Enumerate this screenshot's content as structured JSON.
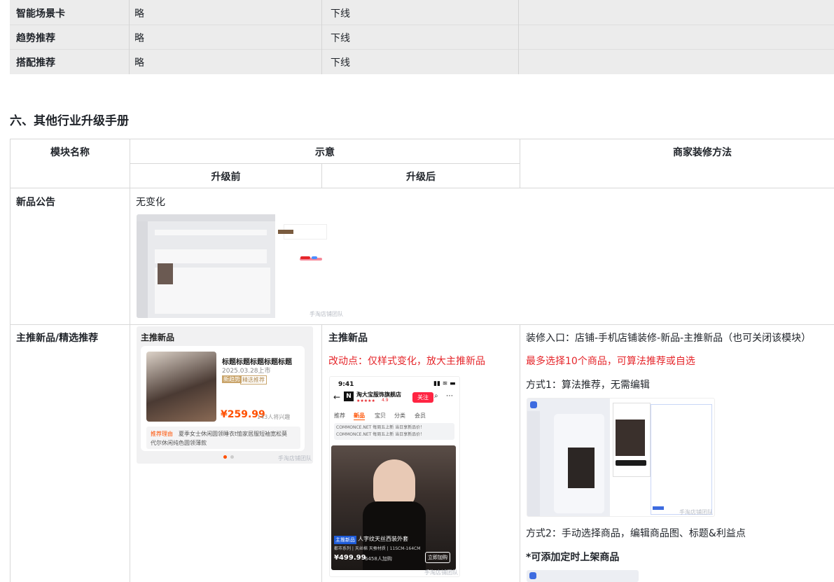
{
  "top_table": {
    "rows": [
      {
        "name": "智能场景卡",
        "col2": "略",
        "col3": "下线"
      },
      {
        "name": "趋势推荐",
        "col2": "略",
        "col3": "下线"
      },
      {
        "name": "搭配推荐",
        "col2": "略",
        "col3": "下线"
      }
    ]
  },
  "section": {
    "title": "六、其他行业升级手册"
  },
  "table": {
    "header": {
      "module": "模块名称",
      "illustration": "示意",
      "method": "商家装修方法",
      "before": "升级前",
      "after": "升级后"
    },
    "row1": {
      "name": "新品公告",
      "note": "无变化",
      "watermark": "手淘店铺团队"
    },
    "row2": {
      "name": "主推新品/精选推荐",
      "before_card": {
        "title": "主推新品",
        "product_title": "标题标题标题标题标题",
        "date": "2025.03.28上市",
        "tag1": "新趋势",
        "tag2": "精选推荐",
        "price": "¥259.99",
        "buyers": "143人将兴趣",
        "reason_label": "推荐理由",
        "reason_text_1": "夏季女士休闲圆领睡衣t恤家居服短袖宽松莫",
        "reason_text_2": "代尔休闲纯色圆领薄款",
        "watermark": "手淘店铺团队"
      },
      "after_title": "主推新品",
      "after_change": "改动点：仅样式变化，放大主推新品",
      "phone": {
        "time": "9:41",
        "shop_name": "淘大宝服饰旗舰店",
        "shop_rating": "4.9",
        "follow": "关注",
        "tabs": [
          "推荐",
          "新品",
          "宝贝",
          "分类",
          "会员"
        ],
        "notice": "COMMONCE.NET 每周五上新 当日享新品价！ COMMONCE.NET 每周五上新 当日享新品价！",
        "badge": "主推新品",
        "product": "人字纹天丝西装外套",
        "spec": "都市系列 | 天丝棉 天蚕材质 | 11SCM-164CM",
        "price": "¥499.99",
        "buyers": "6458人加购",
        "buy": "立即加购",
        "watermark": "手淘店铺团队"
      },
      "method": {
        "entry": "装修入口：店铺-手机店铺装修-新品-主推新品（也可关闭该模块）",
        "limit": "最多选择10个商品，可算法推荐或自选",
        "way1": "方式1：算法推荐，无需编辑",
        "way2": "方式2：手动选择商品，编辑商品图、标题&利益点",
        "note": "*可添加定时上架商品",
        "watermark": "手淘店铺团队"
      }
    }
  },
  "colors": {
    "red": "#e5252a",
    "orange_price": "#ff5000",
    "border": "#d8d8d8"
  }
}
